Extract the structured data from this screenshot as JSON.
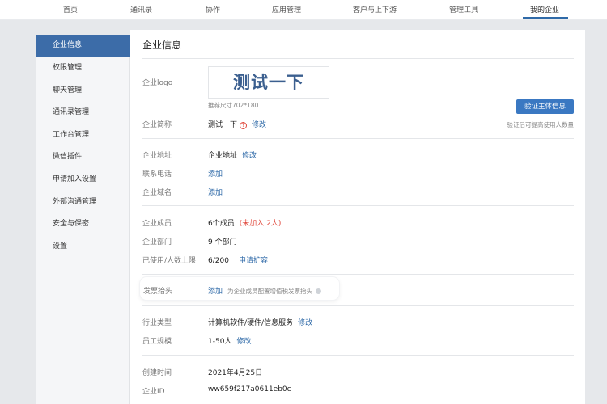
{
  "nav": {
    "items": [
      "首页",
      "通讯录",
      "协作",
      "应用管理",
      "客户与上下游",
      "管理工具",
      "我的企业"
    ],
    "active": "我的企业"
  },
  "sidebar": {
    "items": [
      {
        "label": "企业信息",
        "active": true
      },
      {
        "label": "权限管理"
      },
      {
        "label": "聊天管理"
      },
      {
        "label": "通讯录管理"
      },
      {
        "label": "工作台管理"
      },
      {
        "label": "微信插件"
      },
      {
        "label": "申请加入设置"
      },
      {
        "label": "外部沟通管理"
      },
      {
        "label": "安全与保密"
      },
      {
        "label": "设置"
      }
    ]
  },
  "main": {
    "title": "企业信息",
    "logo": {
      "label": "企业logo",
      "text": "测试一下",
      "hint": "推荐尺寸702*180"
    },
    "verify": {
      "button": "验证主体信息",
      "note": "验证后可提高使用人数量"
    },
    "short_name": {
      "label": "企业简称",
      "value": "测试一下",
      "action": "修改"
    },
    "address": {
      "label": "企业地址",
      "value": "企业地址",
      "action": "修改"
    },
    "phone": {
      "label": "联系电话",
      "action": "添加"
    },
    "domain": {
      "label": "企业域名",
      "action": "添加"
    },
    "members": {
      "label": "企业成员",
      "value": "6个成员",
      "extra": "(未加入 2人)"
    },
    "departments": {
      "label": "企业部门",
      "value": "9 个部门"
    },
    "capacity": {
      "label": "已使用/人数上限",
      "value": "6/200",
      "action": "申请扩容"
    },
    "invoice": {
      "label": "发票抬头",
      "action": "添加",
      "note": "为企业成员配置增值税发票抬头"
    },
    "industry": {
      "label": "行业类型",
      "value": "计算机软件/硬件/信息服务",
      "action": "修改"
    },
    "size": {
      "label": "员工规模",
      "value": "1-50人",
      "action": "修改"
    },
    "created": {
      "label": "创建时间",
      "value": "2021年4月25日"
    },
    "corp_id": {
      "label": "企业ID",
      "value": "ww659f217a0611eb0c"
    }
  }
}
